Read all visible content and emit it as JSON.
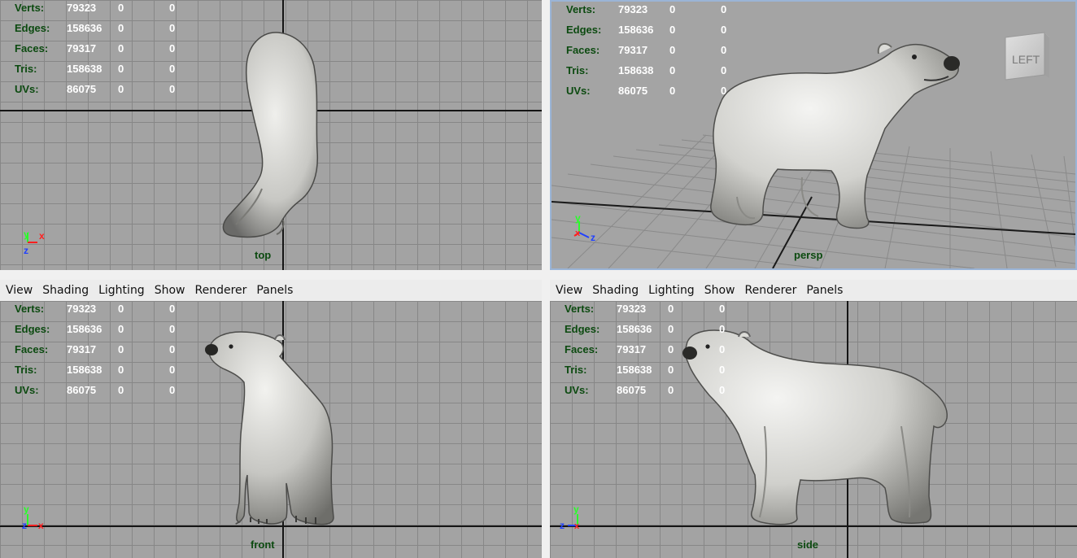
{
  "hud": {
    "labels": [
      "Verts:",
      "Edges:",
      "Faces:",
      "Tris:",
      "UVs:"
    ],
    "rows": [
      {
        "label": "Verts:",
        "v1": "79323",
        "v2": "0",
        "v3": "0"
      },
      {
        "label": "Edges:",
        "v1": "158636",
        "v2": "0",
        "v3": "0"
      },
      {
        "label": "Faces:",
        "v1": "79317",
        "v2": "0",
        "v3": "0"
      },
      {
        "label": "Tris:",
        "v1": "158638",
        "v2": "0",
        "v3": "0"
      },
      {
        "label": "UVs:",
        "v1": "86075",
        "v2": "0",
        "v3": "0"
      }
    ]
  },
  "viewports": {
    "top": {
      "camera": "top"
    },
    "persp": {
      "camera": "persp",
      "viewcube_face": "LEFT"
    },
    "front": {
      "camera": "front"
    },
    "side": {
      "camera": "side"
    }
  },
  "menu": {
    "items": [
      "View",
      "Shading",
      "Lighting",
      "Show",
      "Renderer",
      "Panels"
    ]
  },
  "axes": {
    "x": "x",
    "y": "y",
    "z": "z"
  },
  "colors": {
    "viewport_bg": "#a3a3a3",
    "grid_line": "#878787",
    "hud_label": "#0c4a10",
    "hud_value": "#ffffff",
    "axis_x": "#ff2020",
    "axis_y": "#28ff28",
    "axis_z": "#2040ff",
    "active_border": "#9ab4d6"
  }
}
